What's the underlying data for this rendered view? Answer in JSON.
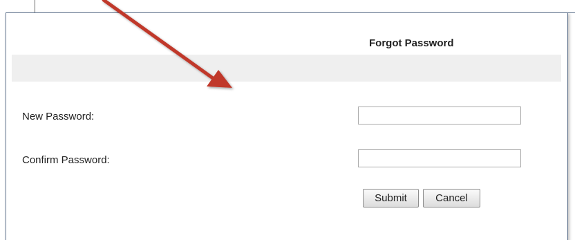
{
  "dialog": {
    "title": "Forgot Password"
  },
  "form": {
    "new_password": {
      "label": "New Password:",
      "value": "",
      "placeholder": ""
    },
    "confirm_password": {
      "label": "Confirm Password:",
      "value": "",
      "placeholder": ""
    },
    "submit_label": "Submit",
    "cancel_label": "Cancel"
  },
  "annotation": {
    "arrow_color": "#c0392b",
    "arrow_icon": "red-arrow-icon"
  },
  "colors": {
    "panel_border": "#5b6f8a",
    "band_background": "#efefef",
    "input_border": "#a9a9a9"
  }
}
